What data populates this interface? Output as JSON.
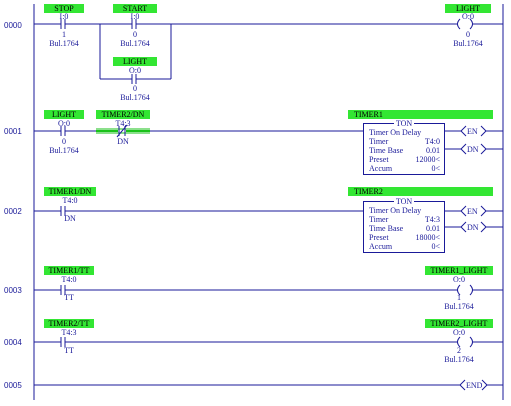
{
  "rungs": [
    "0000",
    "0001",
    "0002",
    "0003",
    "0004",
    "0005"
  ],
  "instr": {
    "stop": {
      "tag": "STOP",
      "addr": "I:0",
      "bit": "1",
      "module": "Bul.1764"
    },
    "start": {
      "tag": "START",
      "addr": "I:0",
      "bit": "0",
      "module": "Bul.1764"
    },
    "light_seal": {
      "tag": "LIGHT",
      "addr": "O:0",
      "bit": "0",
      "module": "Bul.1764"
    },
    "light_out": {
      "tag": "LIGHT",
      "addr": "O:0",
      "bit": "0",
      "module": "Bul.1764"
    },
    "light1": {
      "tag": "LIGHT",
      "addr": "O:0",
      "bit": "0",
      "module": "Bul.1764"
    },
    "timer2dn": {
      "tag": "TIMER2/DN",
      "addr": "T4:3",
      "bit": "DN"
    },
    "timer1dn": {
      "tag": "TIMER1/DN",
      "addr": "T4:0",
      "bit": "DN"
    },
    "timer1tt": {
      "tag": "TIMER1/TT",
      "addr": "T4:0",
      "bit": "TT"
    },
    "timer1_light": {
      "tag": "TIMER1_LIGHT",
      "addr": "O:0",
      "bit": "1",
      "module": "Bul.1764"
    },
    "timer2tt": {
      "tag": "TIMER2/TT",
      "addr": "T4:3",
      "bit": "TT"
    },
    "timer2_light": {
      "tag": "TIMER2_LIGHT",
      "addr": "O:0",
      "bit": "2",
      "module": "Bul.1764"
    }
  },
  "timers": [
    {
      "tag": "TIMER1",
      "type": "TON",
      "desc": "Timer On Delay",
      "timer_label": "Timer",
      "timer": "T4:0",
      "tb_label": "Time Base",
      "time_base": "0.01",
      "preset_label": "Preset",
      "preset": "12000<",
      "accum_label": "Accum",
      "accum": "0<",
      "en": "EN",
      "dn": "DN"
    },
    {
      "tag": "TIMER2",
      "type": "TON",
      "desc": "Timer On Delay",
      "timer_label": "Timer",
      "timer": "T4:3",
      "tb_label": "Time Base",
      "time_base": "0.01",
      "preset_label": "Preset",
      "preset": "18000<",
      "accum_label": "Accum",
      "accum": "0<",
      "en": "EN",
      "dn": "DN"
    }
  ],
  "end_label": "END",
  "colors": {
    "wire": "#1a1a99",
    "tag_bg": "#33e633",
    "active": "#19c219"
  }
}
